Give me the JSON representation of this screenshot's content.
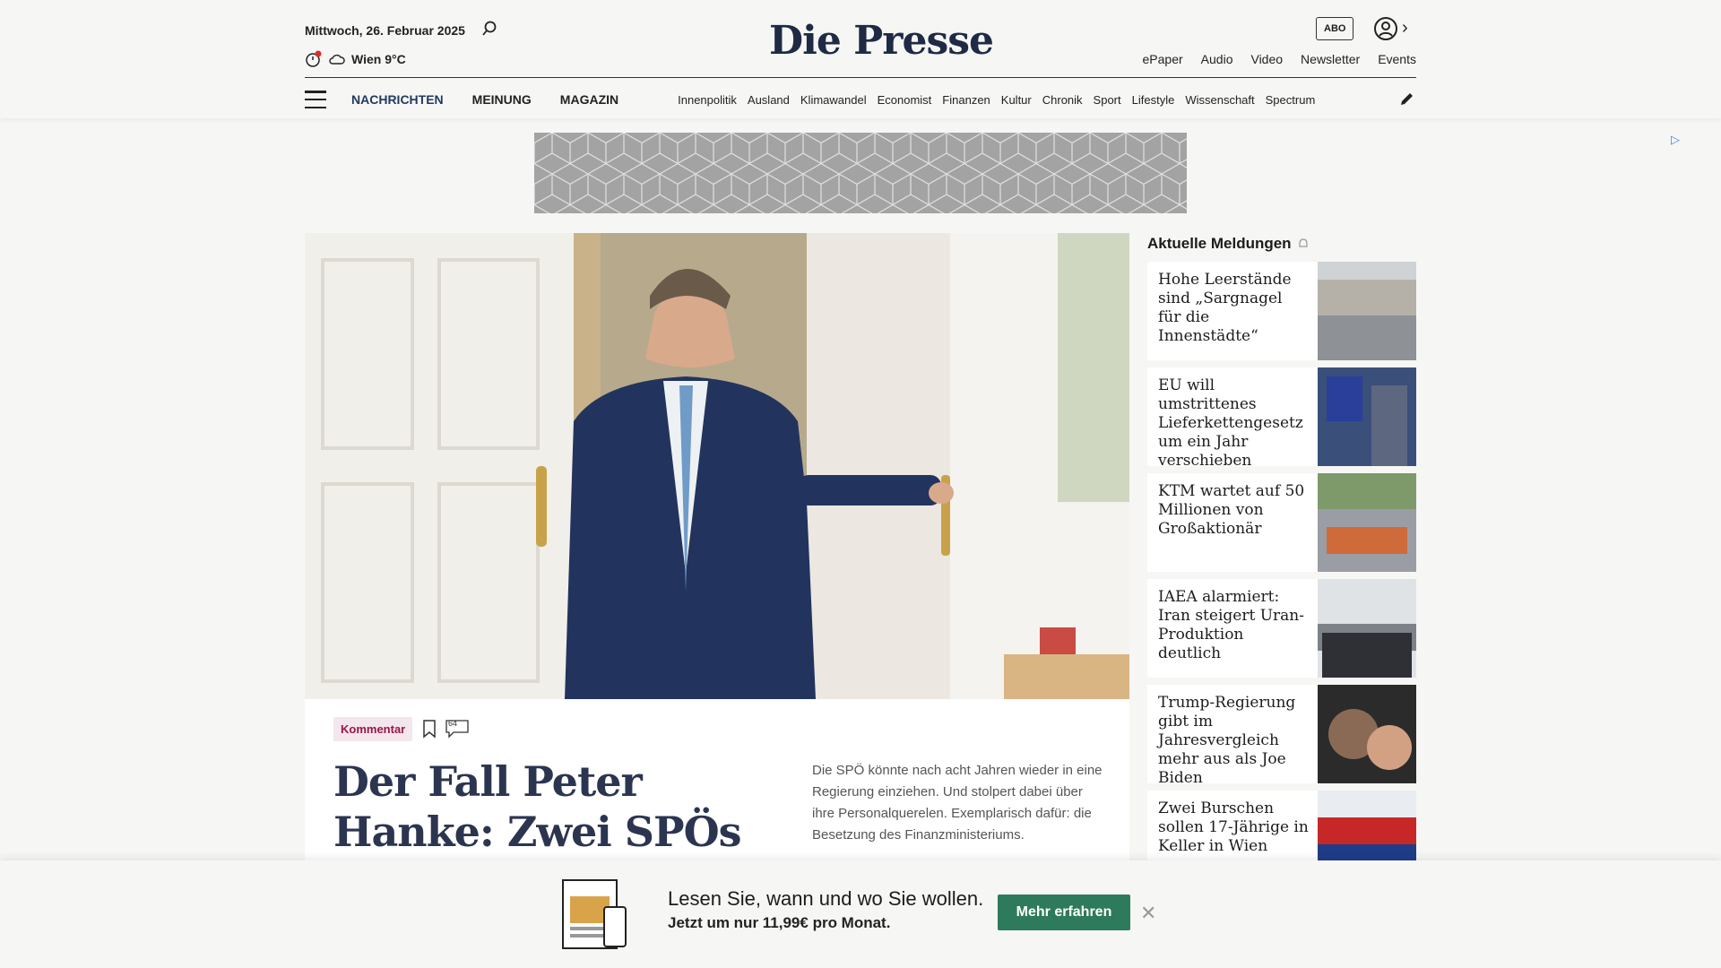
{
  "header": {
    "date": "Mittwoch, 26. Februar 2025",
    "weather": "Wien 9°C",
    "logo": "Die Presse",
    "abo_label": "ABO",
    "top_links": [
      "ePaper",
      "Audio",
      "Video",
      "Newsletter",
      "Events"
    ]
  },
  "nav": {
    "main": [
      "NACHRICHTEN",
      "MEINUNG",
      "MAGAZIN"
    ],
    "sub": [
      "Innenpolitik",
      "Ausland",
      "Klimawandel",
      "Economist",
      "Finanzen",
      "Kultur",
      "Chronik",
      "Sport",
      "Lifestyle",
      "Wissenschaft",
      "Spectrum"
    ]
  },
  "article": {
    "tag": "Kommentar",
    "comment_count": "64",
    "headline": "Der Fall Peter Hanke: Zwei SPÖs suchen",
    "teaser": "Die SPÖ könnte nach acht Jahren wieder in eine Regierung einziehen. Und stolpert dabei über ihre Personalquerelen. Exemplarisch dafür: die Besetzung des Finanzministeriums."
  },
  "sidebar": {
    "title": "Aktuelle Meldungen",
    "items": [
      {
        "text": "Hohe Leerstände sind „Sargnagel für die Innenstädte“"
      },
      {
        "text": "EU will umstrittenes Lieferkettengesetz um ein Jahr verschieben"
      },
      {
        "text": "KTM wartet auf 50 Millionen von Großaktionär"
      },
      {
        "text": "IAEA alarmiert: Iran steigert Uran-Produktion deutlich"
      },
      {
        "text": "Trump-Regierung gibt im Jahresvergleich mehr aus als Joe Biden"
      },
      {
        "text": "Zwei Burschen sollen 17-Jährige in Keller in Wien"
      }
    ]
  },
  "banner": {
    "heading": "Lesen Sie, wann und wo Sie wollen.",
    "sub": "Jetzt um nur 11,99€ pro Monat.",
    "button": "Mehr erfahren"
  }
}
